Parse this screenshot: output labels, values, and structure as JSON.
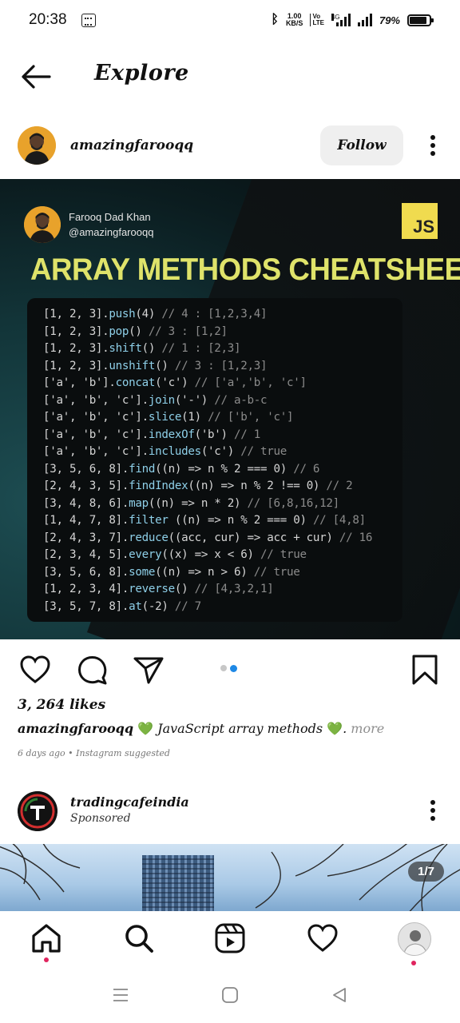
{
  "status_bar": {
    "time": "20:38",
    "speed_value": "1.00",
    "speed_unit": "KB/S",
    "volte_top": "Vo",
    "volte_bottom": "LTE",
    "network": "4G",
    "battery_percent": "79%",
    "battery_level": 0.79
  },
  "header": {
    "title": "Explore",
    "back_icon": "arrow-left-icon"
  },
  "post": {
    "username": "amazingfarooqq",
    "follow_label": "Follow",
    "image": {
      "author_name": "Farooq Dad Khan",
      "author_handle": "@amazingfarooqq",
      "badge": "JS",
      "title": "ARRAY METHODS CHEATSHEET",
      "code_lines": [
        "[1, 2, 3].push(4) // 4 : [1,2,3,4]",
        "[1, 2, 3].pop() // 3 : [1,2]",
        "[1, 2, 3].shift() // 1 : [2,3]",
        "[1, 2, 3].unshift() // 3 : [1,2,3]",
        "['a', 'b'].concat('c') // ['a','b', 'c']",
        "['a', 'b', 'c'].join('-') // a-b-c",
        "['a', 'b', 'c'].slice(1) // ['b', 'c']",
        "['a', 'b', 'c'].indexOf('b') // 1",
        "['a', 'b', 'c'].includes('c') // true",
        "[3, 5, 6, 8].find((n) => n % 2 === 0) // 6",
        "[2, 4, 3, 5].findIndex((n) => n % 2 !== 0) // 2",
        "[3, 4, 8, 6].map((n) => n * 2) // [6,8,16,12]",
        "[1, 4, 7, 8].filter ((n) => n % 2 === 0) // [4,8]",
        "[2, 4, 3, 7].reduce((acc, cur) => acc + cur) // 16",
        "[2, 3, 4, 5].every((x) => x < 6) // true",
        "[3, 5, 6, 8].some((n) => n > 6) // true",
        "[1, 2, 3, 4].reverse() // [4,3,2,1]",
        "[3, 5, 7, 8].at(-2) // 7"
      ]
    },
    "likes": "3, 264 likes",
    "caption_user": "amazingfarooqq",
    "caption_text": "JavaScript array methods",
    "caption_emoji": "💚",
    "caption_more": "more",
    "meta": "6 days ago • Instagram suggested"
  },
  "post2": {
    "username": "tradingcafeindia",
    "sponsored": "Sponsored",
    "carousel_counter": "1/7"
  },
  "icons": {
    "like": "heart-icon",
    "comment": "comment-icon",
    "share": "send-icon",
    "save": "bookmark-icon",
    "home": "home-icon",
    "search": "search-icon",
    "reels": "reels-icon",
    "activity": "heart-icon"
  },
  "colors": {
    "title_yellow": "#dfe36a",
    "js_yellow": "#f0db4f",
    "carousel_active": "#1e88e5",
    "notification_dot": "#e0245e"
  }
}
